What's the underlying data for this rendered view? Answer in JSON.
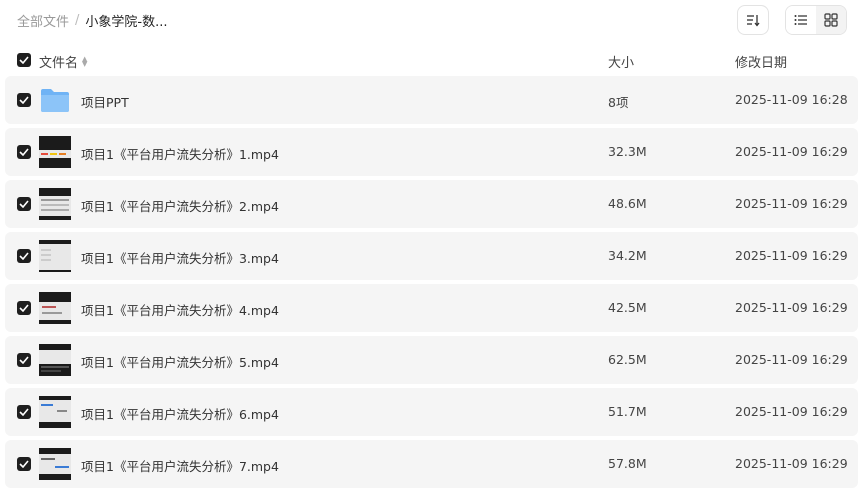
{
  "breadcrumb": {
    "root": "全部文件",
    "separator": "/",
    "current": "小象学院-数..."
  },
  "toolbar": {
    "sort_icon": "sort-icon",
    "list_icon": "list-view-icon",
    "grid_icon": "grid-view-icon"
  },
  "columns": {
    "name": "文件名",
    "size": "大小",
    "date": "修改日期"
  },
  "files": [
    {
      "name": "项目PPT",
      "size": "8项",
      "date": "2025-11-09 16:28",
      "type": "folder"
    },
    {
      "name": "项目1《平台用户流失分析》1.mp4",
      "size": "32.3M",
      "date": "2025-11-09 16:29",
      "type": "video"
    },
    {
      "name": "项目1《平台用户流失分析》2.mp4",
      "size": "48.6M",
      "date": "2025-11-09 16:29",
      "type": "video"
    },
    {
      "name": "项目1《平台用户流失分析》3.mp4",
      "size": "34.2M",
      "date": "2025-11-09 16:29",
      "type": "video"
    },
    {
      "name": "项目1《平台用户流失分析》4.mp4",
      "size": "42.5M",
      "date": "2025-11-09 16:29",
      "type": "video"
    },
    {
      "name": "项目1《平台用户流失分析》5.mp4",
      "size": "62.5M",
      "date": "2025-11-09 16:29",
      "type": "video"
    },
    {
      "name": "项目1《平台用户流失分析》6.mp4",
      "size": "51.7M",
      "date": "2025-11-09 16:29",
      "type": "video"
    },
    {
      "name": "项目1《平台用户流失分析》7.mp4",
      "size": "57.8M",
      "date": "2025-11-09 16:29",
      "type": "video"
    }
  ],
  "colors": {
    "row_background": "#f5f5f5",
    "checkbox": "#1f1f1f",
    "folder": "#6fb3f5"
  }
}
